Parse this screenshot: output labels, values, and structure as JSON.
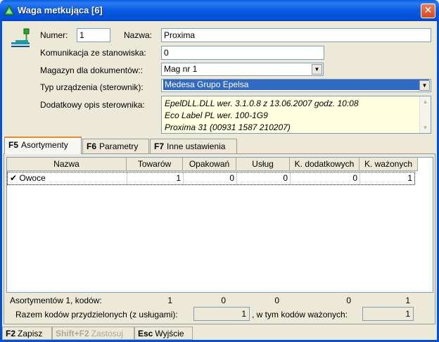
{
  "window": {
    "title": "Waga metkująca [6]",
    "close_glyph": "✕"
  },
  "form": {
    "numer_label": "Numer:",
    "numer_value": "1",
    "nazwa_label": "Nazwa:",
    "nazwa_value": "Proxima",
    "komunikacja_label": "Komunikacja ze stanowiska:",
    "komunikacja_value": "0",
    "magazyn_label": "Magazyn dla dokumentów::",
    "magazyn_value": "Mag nr 1",
    "typ_label": "Typ urządzenia (sterownik):",
    "typ_value": "Medesa Grupo Epelsa",
    "opis_label": "Dodatkowy opis sterownika:",
    "opis_lines": [
      "EpelDLL.DLL wer. 3.1.0.8 z 13.06.2007 godz. 10:08",
      "Eco Label PL wer. 100-1G9",
      "Proxima 31 (00931 1587 210207)"
    ]
  },
  "tabs": [
    {
      "key": "F5",
      "label": "Asortymenty"
    },
    {
      "key": "F6",
      "label": "Parametry"
    },
    {
      "key": "F7",
      "label": "Inne ustawienia"
    }
  ],
  "grid": {
    "columns": [
      "Nazwa",
      "Towarów",
      "Opakowań",
      "Usług",
      "K. dodatkowych",
      "K. ważonych"
    ],
    "rows": [
      {
        "check": "✔",
        "name": "Owoce",
        "towarow": "1",
        "opakowan": "0",
        "uslug": "0",
        "dodatkowych": "0",
        "wazonych": "1"
      }
    ]
  },
  "summary": {
    "label": "Asortymentów 1, kodów:",
    "towarow": "1",
    "opakowan": "0",
    "uslug": "0",
    "dodatkowych": "0",
    "wazonych": "1",
    "razem_label": "Razem kodów przydzielonych (z usługami):",
    "razem_value": "1",
    "wazonych_label": ", w tym kodów ważonych:",
    "wazonych_value": "1"
  },
  "statusbar": [
    {
      "key": "F2",
      "label": "Zapisz",
      "enabled": true
    },
    {
      "key": "Shift+F2",
      "label": "Zastosuj",
      "enabled": false
    },
    {
      "key": "Esc",
      "label": "Wyjście",
      "enabled": true
    }
  ],
  "colors": {
    "titlebar": "#0a5ae0",
    "selection": "#316ac5",
    "tab_accent": "#e68b2c",
    "description_bg": "#ffffe1"
  },
  "icons": {
    "app": "green-arrow-icon",
    "scale": "scale-icon",
    "dropdown": "chevron-down-icon",
    "check": "check-icon"
  }
}
